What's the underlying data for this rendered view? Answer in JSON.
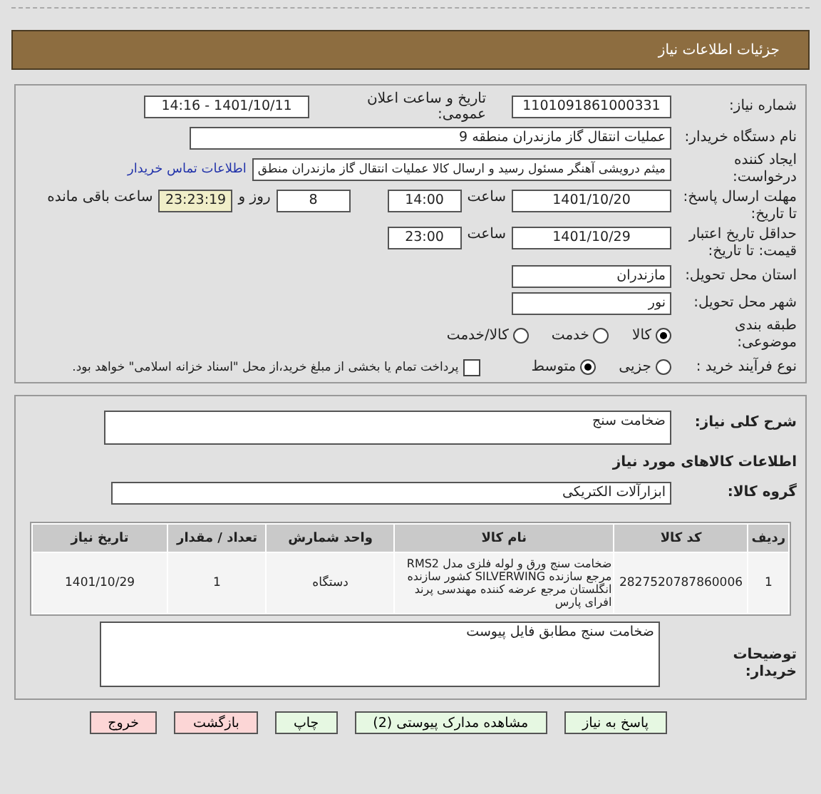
{
  "header": {
    "title": "جزئیات اطلاعات نیاز"
  },
  "need_number": {
    "label": "شماره نیاز:",
    "value": "1101091861000331"
  },
  "announce": {
    "label": "تاریخ و ساعت اعلان عمومی:",
    "value": "1401/10/11 - 14:16"
  },
  "buyer": {
    "label": "نام دستگاه خریدار:",
    "value": "عملیات انتقال گاز مازندران منطقه 9"
  },
  "requester": {
    "label": "ایجاد کننده درخواست:",
    "value": "میثم درویشی آهنگر مسئول رسید و ارسال کالا عملیات انتقال گاز مازندران منطق",
    "link": "اطلاعات تماس خریدار"
  },
  "deadline": {
    "label": "مهلت ارسال پاسخ: تا تاریخ:",
    "date": "1401/10/20",
    "time_label": "ساعت",
    "time": "14:00",
    "days": "8",
    "days_label": "روز و",
    "remaining": "23:23:19",
    "remaining_label": "ساعت باقی مانده"
  },
  "validity": {
    "label": "حداقل تاریخ اعتبار قیمت: تا تاریخ:",
    "date": "1401/10/29",
    "time_label": "ساعت",
    "time": "23:00"
  },
  "province": {
    "label": "استان محل تحویل:",
    "value": "مازندران"
  },
  "city": {
    "label": "شهر محل تحویل:",
    "value": "نور"
  },
  "category": {
    "label": "طبقه بندی موضوعی:",
    "options": [
      {
        "label": "کالا",
        "selected": true
      },
      {
        "label": "خدمت",
        "selected": false
      },
      {
        "label": "کالا/خدمت",
        "selected": false
      }
    ]
  },
  "process": {
    "label": "نوع فرآیند خرید :",
    "options": [
      {
        "label": "جزیی",
        "selected": false
      },
      {
        "label": "متوسط",
        "selected": true
      }
    ],
    "payment": {
      "checked": false,
      "text": "پرداخت تمام یا بخشی از مبلغ خرید،از محل \"اسناد خزانه اسلامی\" خواهد بود."
    }
  },
  "description": {
    "label": "شرح کلی نیاز:",
    "value": "ضخامت سنج"
  },
  "goods_title": "اطلاعات کالاهای مورد نیاز",
  "group": {
    "label": "گروه کالا:",
    "value": "ابزارآلات الکتریکی"
  },
  "table": {
    "columns": [
      "ردیف",
      "کد کالا",
      "نام کالا",
      "واحد شمارش",
      "تعداد / مقدار",
      "تاریخ نیاز"
    ],
    "rows": [
      [
        "1",
        "2827520787860006",
        "ضخامت سنج ورق و لوله فلزی مدل RMS2 مرجع سازنده SILVERWING کشور سازنده انگلستان مرجع عرضه کننده مهندسی پرند افرای پارس",
        "دستگاه",
        "1",
        "1401/10/29"
      ]
    ]
  },
  "notes": {
    "label": "توضیحات خریدار:",
    "value": "ضخامت سنج مطابق فایل پیوست"
  },
  "buttons": [
    {
      "label": "پاسخ به نیاز",
      "kind": "normal"
    },
    {
      "label": "مشاهده مدارک پیوستی (2)",
      "kind": "normal"
    },
    {
      "label": "چاپ",
      "kind": "normal"
    },
    {
      "label": "بازگشت",
      "kind": "danger"
    },
    {
      "label": "خروج",
      "kind": "danger"
    }
  ]
}
